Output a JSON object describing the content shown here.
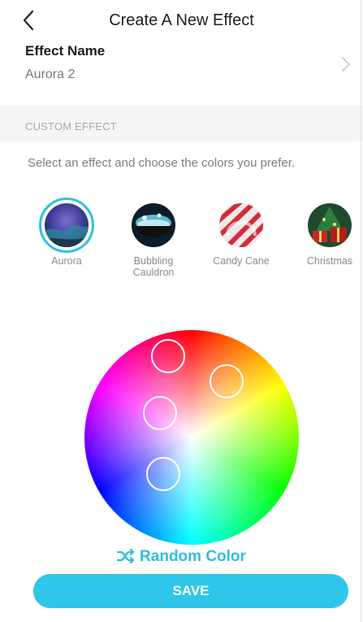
{
  "header": {
    "title": "Create A New Effect"
  },
  "effect_name": {
    "label": "Effect Name",
    "value": "Aurora 2"
  },
  "custom_effect": {
    "section_title": "CUSTOM EFFECT",
    "instructions": "Select an effect and choose the colors you prefer."
  },
  "effects": [
    {
      "label": "Aurora",
      "selected": true
    },
    {
      "label": "Bubbling\nCauldron",
      "selected": false
    },
    {
      "label": "Candy Cane",
      "selected": false
    },
    {
      "label": "Christmas",
      "selected": false
    }
  ],
  "random_color": {
    "label": "Random Color"
  },
  "save": {
    "label": "SAVE"
  },
  "colors": {
    "accent": "#2fc6ea",
    "ring": "#2fc0e4",
    "section_bg": "#f5f5f5"
  }
}
